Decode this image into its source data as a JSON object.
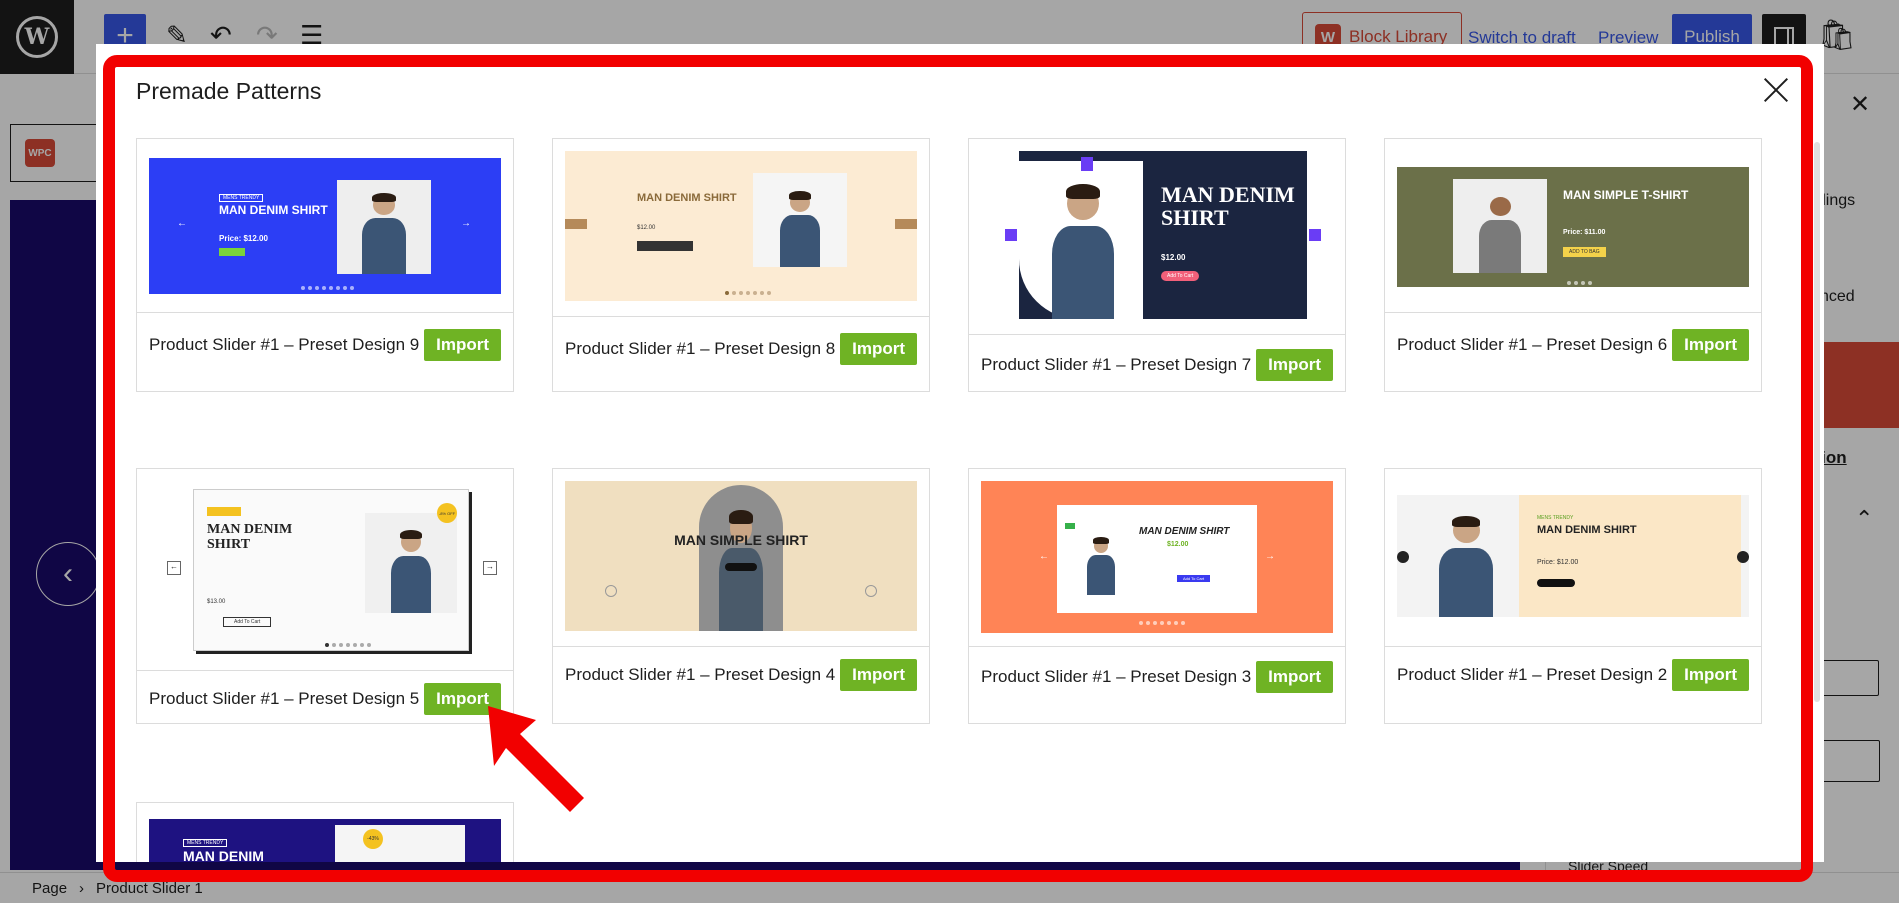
{
  "topbar": {
    "block_library_label": "Block Library",
    "switch_to_draft_label": "Switch to draft",
    "preview_label": "Preview",
    "publish_label": "Publish"
  },
  "sidebar": {
    "text_headings": "adings",
    "text_advanced": "nced",
    "link_text": "ntation",
    "slider_speed_label": "Slider Speed"
  },
  "breadcrumb": {
    "items": [
      "Page",
      "Product Slider 1"
    ]
  },
  "modal": {
    "title": "Premade Patterns",
    "cards": [
      {
        "label": "Product Slider #1 – Preset Design 9",
        "import": "Import",
        "thumb": {
          "headline": "MAN DENIM SHIRT",
          "price": "Price: $12.00",
          "tag": "MENS  TRENDY"
        }
      },
      {
        "label": "Product Slider #1 – Preset Design 8",
        "import": "Import",
        "thumb": {
          "headline": "MAN DENIM SHIRT",
          "price": "$12.00"
        }
      },
      {
        "label": "Product Slider #1 – Preset Design 7",
        "import": "Import",
        "thumb": {
          "headline": "MAN DENIM SHIRT",
          "price": "$12.00",
          "button": "Add To Cart"
        }
      },
      {
        "label": "Product Slider #1 – Preset Design 6",
        "import": "Import",
        "thumb": {
          "headline": "MAN SIMPLE T-SHIRT",
          "price": "Price: $11.00",
          "button": "ADD TO BAG"
        }
      },
      {
        "label": "Product Slider #1 – Preset Design 5",
        "import": "Import",
        "thumb": {
          "headline": "MAN DENIM SHIRT",
          "price": "$13.00",
          "button": "Add To Cart",
          "badge": "-8% OFF"
        }
      },
      {
        "label": "Product Slider #1 – Preset Design 4",
        "import": "Import",
        "thumb": {
          "headline": "MAN SIMPLE SHIRT"
        }
      },
      {
        "label": "Product Slider #1 – Preset Design 3",
        "import": "Import",
        "thumb": {
          "headline": "MAN DENIM SHIRT",
          "price": "$12.00",
          "button": "Add To Cart"
        }
      },
      {
        "label": "Product Slider #1 – Preset Design 2",
        "import": "Import",
        "thumb": {
          "headline": "MAN DENIM SHIRT",
          "price": "Price: $12.00",
          "tag": "MENS TRENDY"
        }
      },
      {
        "label": "",
        "import": "",
        "thumb": {
          "headline": "MAN DENIM",
          "tag": "MENS  TRENDY",
          "badge": "-43%"
        }
      }
    ]
  },
  "colors": {
    "import_green": "#6fb324",
    "annotation_red": "#f20000",
    "wp_blue": "#3858e9"
  }
}
